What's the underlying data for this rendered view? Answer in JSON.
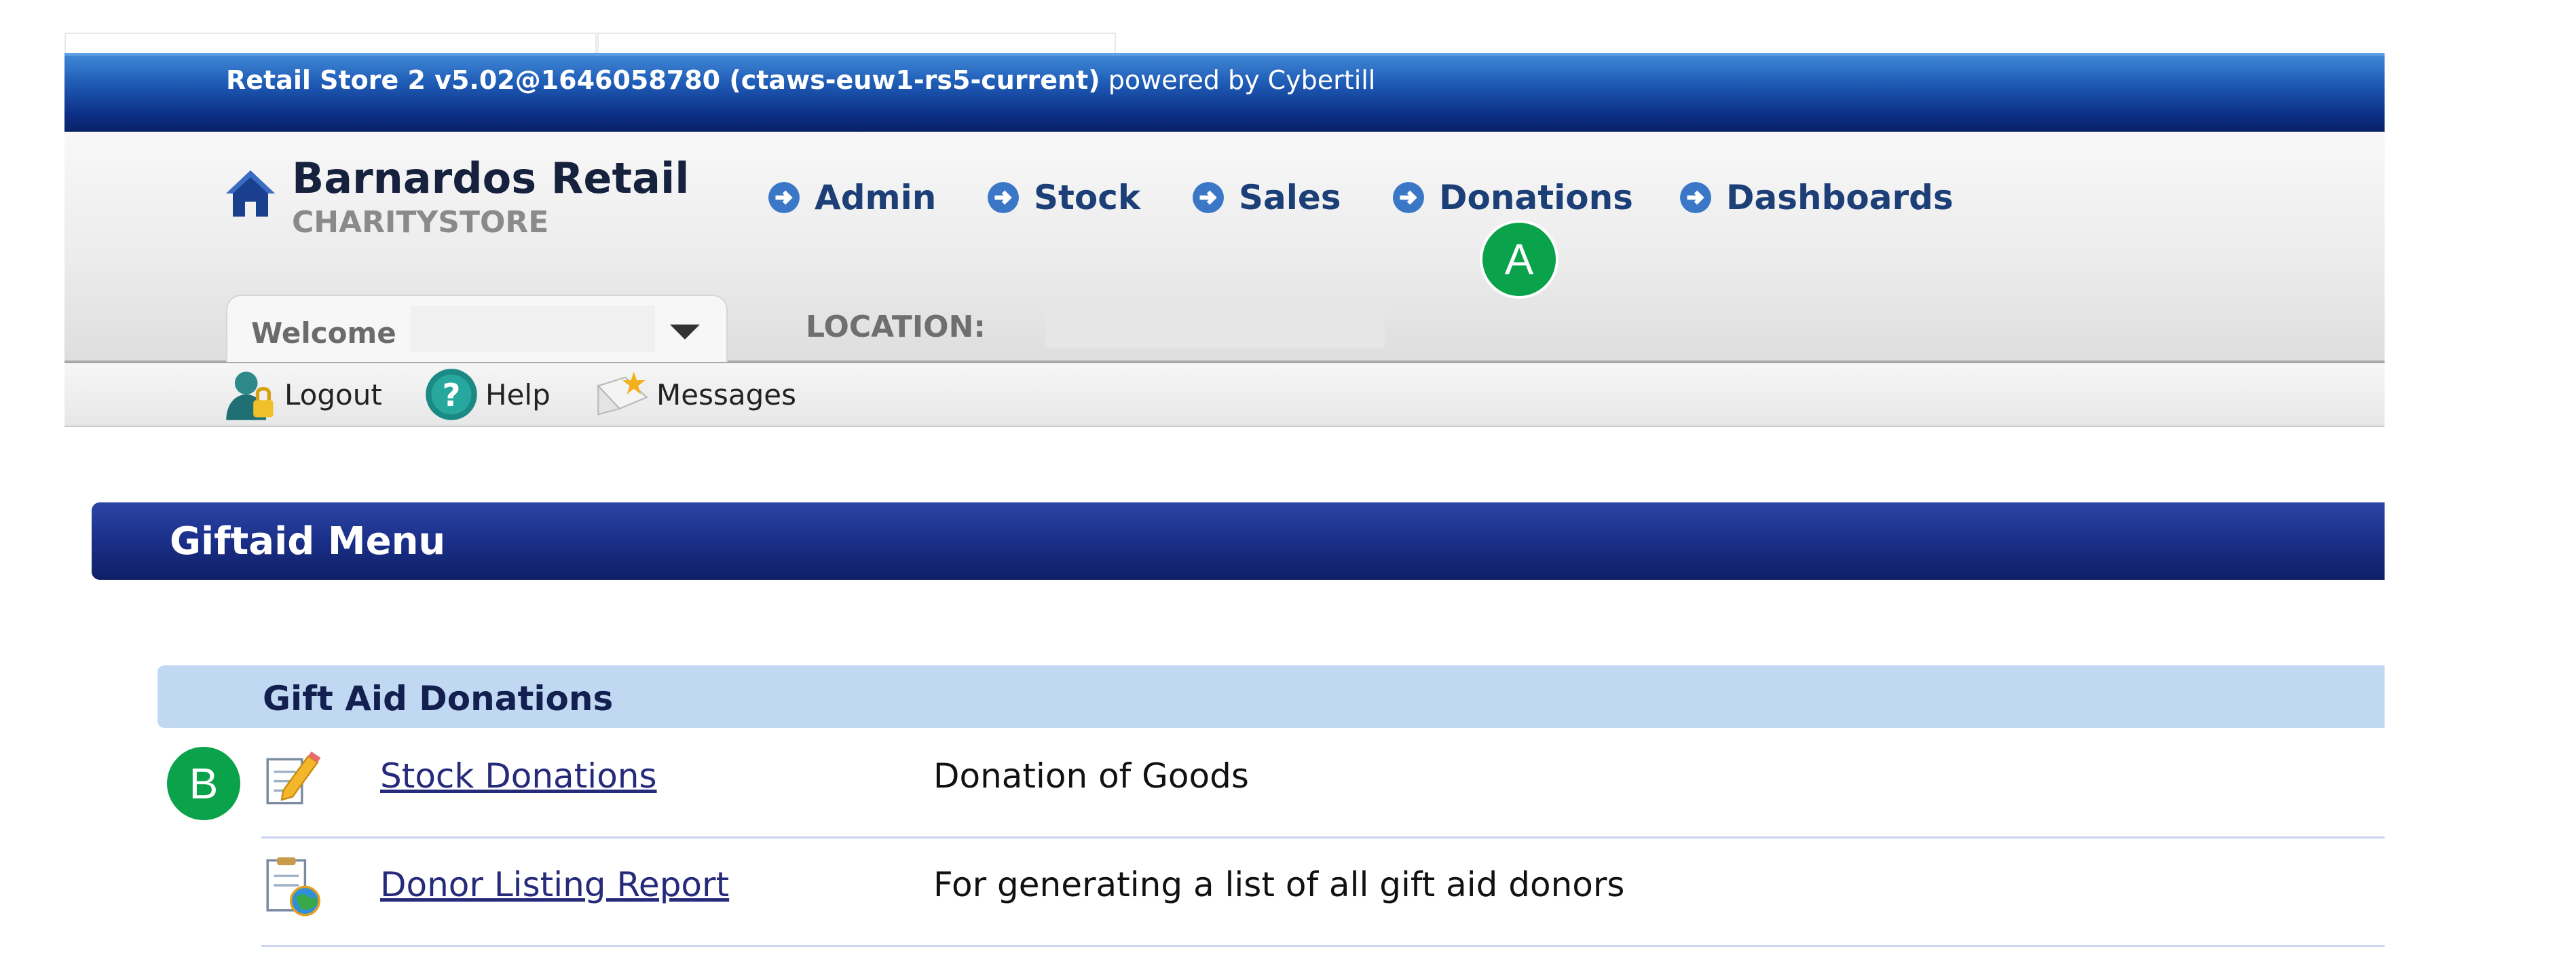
{
  "app": {
    "version_label": "Retail Store 2 v5.02@1646058780 (ctaws-euw1-rs5-current)",
    "powered_by": "powered by Cybertill"
  },
  "brand": {
    "title": "Barnardos Retail",
    "subtitle": "CHARITYSTORE",
    "icon": "home-icon"
  },
  "nav": {
    "items": [
      {
        "label": "Admin",
        "icon": "arrow-circle-icon"
      },
      {
        "label": "Stock",
        "icon": "arrow-circle-icon"
      },
      {
        "label": "Sales",
        "icon": "arrow-circle-icon"
      },
      {
        "label": "Donations",
        "icon": "arrow-circle-icon"
      },
      {
        "label": "Dashboards",
        "icon": "arrow-circle-icon"
      }
    ]
  },
  "annotations": {
    "a": "A",
    "b": "B",
    "color": "#0aa24a"
  },
  "welcome": {
    "label": "Welcome",
    "value": ""
  },
  "location": {
    "label": "LOCATION:",
    "value": ""
  },
  "toolbar": {
    "logout": "Logout",
    "help": "Help",
    "messages": "Messages"
  },
  "menu": {
    "title": "Giftaid Menu"
  },
  "section": {
    "title": "Gift Aid Donations",
    "rows": [
      {
        "link": "Stock Donations",
        "description": "Donation of Goods",
        "icon": "notepad-pencil-icon"
      },
      {
        "link": "Donor Listing Report",
        "description": "For generating a list of all gift aid donors",
        "icon": "report-globe-icon"
      }
    ]
  },
  "colors": {
    "topbar": "#0c2f86",
    "nav_text": "#1c3f78",
    "menu_bar": "#1a2f88",
    "section_head": "#c0d8f2",
    "link": "#262a7a"
  }
}
